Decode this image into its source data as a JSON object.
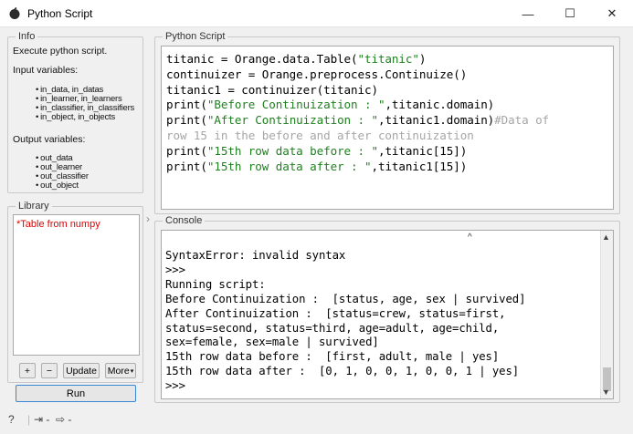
{
  "window": {
    "title": "Python Script",
    "controls": {
      "minimize": "—",
      "maximize": "☐",
      "close": "✕"
    }
  },
  "info": {
    "group_title": "Info",
    "description": "Execute python script.",
    "input_label": "Input variables:",
    "inputs": [
      "in_data, in_datas",
      "in_learner, in_learners",
      "in_classifier, in_classifiers",
      "in_object, in_objects"
    ],
    "output_label": "Output variables:",
    "outputs": [
      "out_data",
      "out_learner",
      "out_classifier",
      "out_object"
    ]
  },
  "library": {
    "group_title": "Library",
    "items": [
      "*Table from numpy"
    ],
    "buttons": {
      "add": "+",
      "remove": "−",
      "update": "Update",
      "more": "More"
    }
  },
  "run_button": "Run",
  "script": {
    "group_title": "Python Script",
    "lines": [
      [
        {
          "t": "titanic = Orange.data.Table(",
          "c": "code"
        },
        {
          "t": "\"titanic\"",
          "c": "str"
        },
        {
          "t": ")",
          "c": "code"
        }
      ],
      [
        {
          "t": "continuizer = Orange.preprocess.Continuize()",
          "c": "code"
        }
      ],
      [
        {
          "t": "titanic1 = continuizer(titanic)",
          "c": "code"
        }
      ],
      [
        {
          "t": "print(",
          "c": "code"
        },
        {
          "t": "\"Before Continuization : \"",
          "c": "str"
        },
        {
          "t": ",titanic.domain)",
          "c": "code"
        }
      ],
      [
        {
          "t": "print(",
          "c": "code"
        },
        {
          "t": "\"After Continuization : \"",
          "c": "str"
        },
        {
          "t": ",titanic1.domain)",
          "c": "code"
        },
        {
          "t": "#Data of",
          "c": "cmt"
        }
      ],
      [
        {
          "t": "row 15 in the before and after continuization",
          "c": "cmt"
        }
      ],
      [
        {
          "t": "print(",
          "c": "code"
        },
        {
          "t": "\"15th row data before : \"",
          "c": "str"
        },
        {
          "t": ",titanic[15])",
          "c": "code"
        }
      ],
      [
        {
          "t": "print(",
          "c": "code"
        },
        {
          "t": "\"15th row data after : \"",
          "c": "str"
        },
        {
          "t": ",titanic1[15])",
          "c": "code"
        }
      ]
    ]
  },
  "console": {
    "group_title": "Console",
    "lines": [
      "SyntaxError: invalid syntax",
      ">>>",
      "Running script:",
      "Before Continuization :  [status, age, sex | survived]",
      "After Continuization :  [status=crew, status=first,",
      "status=second, status=third, age=adult, age=child,",
      "sex=female, sex=male | survived]",
      "15th row data before :  [first, adult, male | yes]",
      "15th row data after :  [0, 1, 0, 0, 1, 0, 0, 1 | yes]",
      ">>>"
    ]
  },
  "footer": {
    "help": "?",
    "in": "⇥ -",
    "out": "⇨ -"
  },
  "colors": {
    "string": "#1f7f1f",
    "comment": "#a6a6a6",
    "library_item": "#e00000",
    "run_focus": "#3a86d6"
  }
}
